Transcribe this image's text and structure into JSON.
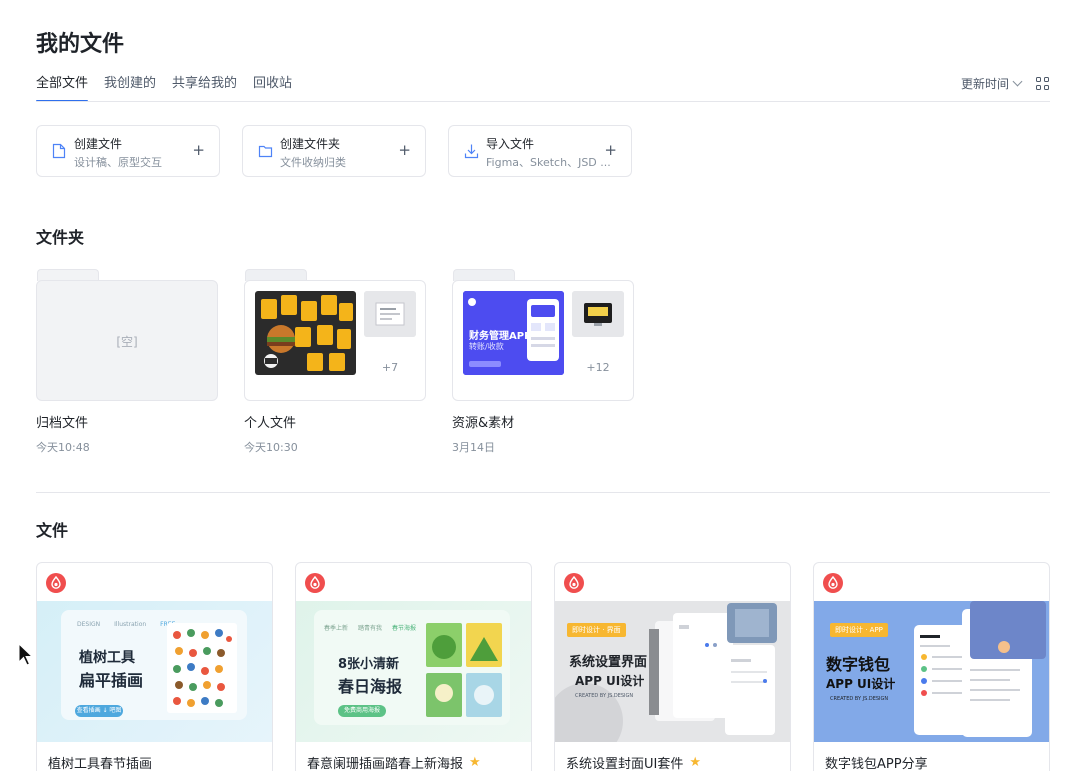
{
  "page": {
    "title": "我的文件"
  },
  "tabs": [
    {
      "label": "全部文件",
      "active": true
    },
    {
      "label": "我创建的",
      "active": false
    },
    {
      "label": "共享给我的",
      "active": false
    },
    {
      "label": "回收站",
      "active": false
    }
  ],
  "toolbar": {
    "sort_label": "更新时间",
    "view_icon": "grid-view-icon"
  },
  "actions": [
    {
      "title": "创建文件",
      "subtitle": "设计稿、原型交互",
      "icon": "file-icon"
    },
    {
      "title": "创建文件夹",
      "subtitle": "文件收纳归类",
      "icon": "folder-icon"
    },
    {
      "title": "导入文件",
      "subtitle": "Figma、Sketch、JSD ...",
      "icon": "import-icon"
    }
  ],
  "sections": {
    "folders_title": "文件夹",
    "files_title": "文件"
  },
  "folders": [
    {
      "name": "归档文件",
      "time": "今天10:48",
      "empty_label": "[空]",
      "more": ""
    },
    {
      "name": "个人文件",
      "time": "今天10:30",
      "more": "+7"
    },
    {
      "name": "资源&素材",
      "time": "3月14日",
      "more": "+12",
      "thumb_title": "财务管理APP",
      "thumb_sub": "转账/收款"
    }
  ],
  "files": [
    {
      "name": "植树工具春节插画",
      "starred": false,
      "cover": {
        "tags": [
          "DESIGN",
          "Illustration",
          "FREE"
        ],
        "line1": "植树工具",
        "line2": "扁平插画",
        "button": "查看插画 ↓ 吧图"
      }
    },
    {
      "name": "春意阑珊插画踏春上新海报",
      "starred": true,
      "cover": {
        "tags": [
          "春季上新",
          "踏青有我",
          "春节海报"
        ],
        "line1": "8张小清新",
        "line2": "春日海报",
        "button": "免费商用海报"
      }
    },
    {
      "name": "系统设置封面UI套件",
      "starred": true,
      "cover": {
        "badge": "即时设计 · 界面",
        "line1": "系统设置界面",
        "line2": "APP UI设计",
        "credit": "CREATED BY JS.DESIGN"
      }
    },
    {
      "name": "数字钱包APP分享",
      "starred": false,
      "cover": {
        "badge": "即时设计 · APP",
        "line1": "数字钱包",
        "line2": "APP UI设计",
        "credit": "CREATED BY JS.DESIGN"
      }
    }
  ],
  "colors": {
    "accent": "#2f6fed",
    "star": "#f7b731",
    "logo_red": "#f04e4e"
  }
}
